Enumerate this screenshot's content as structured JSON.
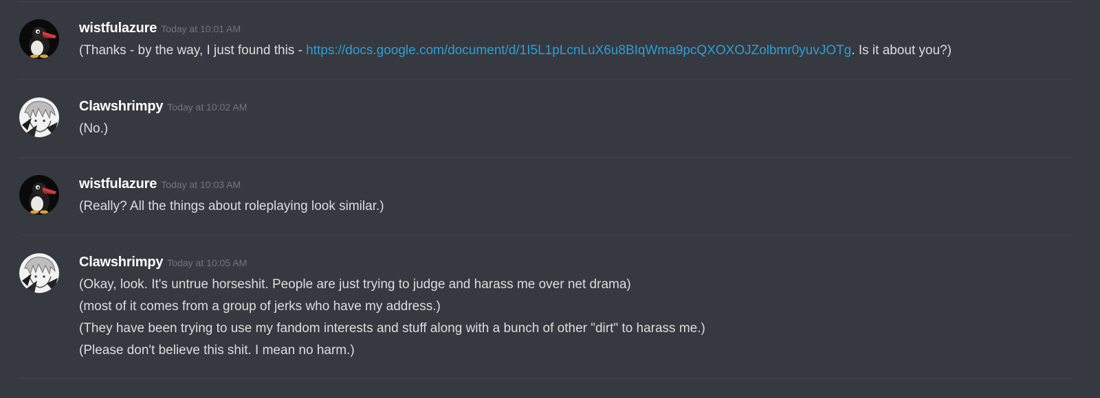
{
  "messages": [
    {
      "username": "wistfulazure",
      "timestamp": "Today at 10:01 AM",
      "avatar": "penguin-avatar",
      "text_before": "(Thanks - by the way, I just found this - ",
      "link": "https://docs.google.com/document/d/1I5L1pLcnLuX6u8BIqWma9pcQXOXOJZolbmr0yuvJOTg",
      "text_after": ". Is it about you?)"
    },
    {
      "username": "Clawshrimpy",
      "timestamp": "Today at 10:02 AM",
      "avatar": "anime-character-avatar",
      "lines": [
        "(No.)"
      ]
    },
    {
      "username": "wistfulazure",
      "timestamp": "Today at 10:03 AM",
      "avatar": "penguin-avatar",
      "lines": [
        "(Really? All the things about roleplaying look similar.)"
      ]
    },
    {
      "username": "Clawshrimpy",
      "timestamp": "Today at 10:05 AM",
      "avatar": "anime-character-avatar",
      "lines": [
        "(Okay, look. It's untrue horseshit. People are just trying to judge and harass me over net drama)",
        "(most of it comes from a group of jerks who have my address.)",
        "(They have been trying to use my fandom interests and stuff along with a bunch of other \"dirt\" to harass me.)",
        "(Please don't believe this shit. I mean no harm.)"
      ]
    }
  ],
  "colors": {
    "background": "#36393f",
    "divider": "#40434a",
    "username": "#ffffff",
    "timestamp": "#72767d",
    "text": "#dcddde",
    "link": "#2a9fd9"
  }
}
